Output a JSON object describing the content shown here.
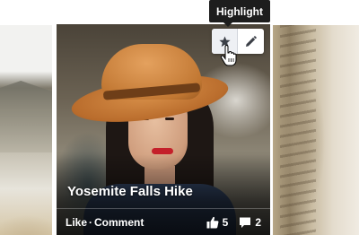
{
  "tooltip": {
    "text": "Highlight"
  },
  "toolbar": {
    "highlight_icon": "star-icon",
    "edit_icon": "pencil-icon"
  },
  "card": {
    "title": "Yosemite Falls Hike",
    "actions": {
      "like": "Like",
      "separator": " · ",
      "comment": "Comment"
    },
    "likes_count": "5",
    "comments_count": "2",
    "likes_icon": "thumbs-up-icon",
    "comments_icon": "comment-icon"
  },
  "colors": {
    "tooltip_bg": "#1d1d1d",
    "toolbar_bg": "#ffffff",
    "text": "#ffffff"
  }
}
